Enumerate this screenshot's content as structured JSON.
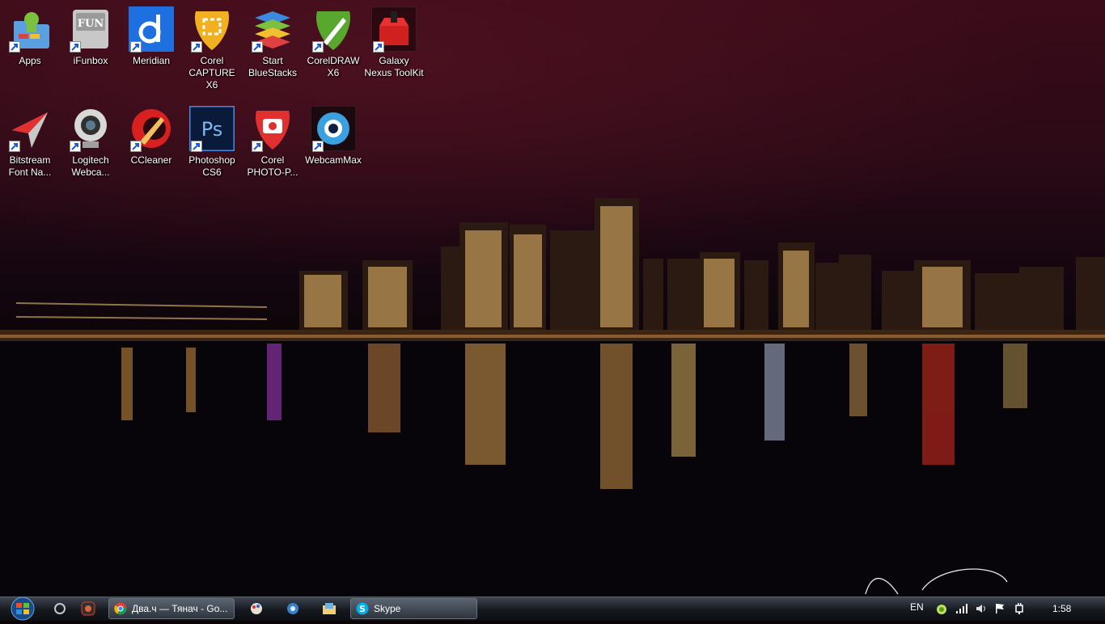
{
  "desktop": {
    "icons": [
      {
        "label": "Apps",
        "icon": "bluestacks-apps-folder-icon"
      },
      {
        "label": "iFunbox",
        "icon": "ifunbox-icon"
      },
      {
        "label": "Meridian",
        "icon": "meridian-icon"
      },
      {
        "label": "Corel CAPTURE X6",
        "icon": "corel-capture-icon"
      },
      {
        "label": "Start BlueStacks",
        "icon": "bluestacks-icon"
      },
      {
        "label": "CorelDRAW X6",
        "icon": "coreldraw-icon"
      },
      {
        "label": "Galaxy Nexus ToolKit",
        "icon": "toolkit-icon"
      },
      {
        "label": "Bitstream Font Na...",
        "icon": "bitstream-icon"
      },
      {
        "label": "Logitech Webca...",
        "icon": "webcam-icon"
      },
      {
        "label": "CCleaner",
        "icon": "ccleaner-icon"
      },
      {
        "label": "Photoshop CS6",
        "icon": "photoshop-icon"
      },
      {
        "label": "Corel PHOTO-P...",
        "icon": "corel-photo-paint-icon"
      },
      {
        "label": "WebcamMax",
        "icon": "webcammax-icon"
      }
    ]
  },
  "taskbar": {
    "tasks": [
      {
        "label": "Два.ч — Тянач - Go...",
        "icon": "chrome-icon"
      },
      {
        "label": "Skype",
        "icon": "skype-icon"
      }
    ],
    "tray": {
      "language": "EN",
      "clock": "1:58"
    }
  },
  "colors": {
    "sky_top": "#3a0c18",
    "water": "#05030a",
    "taskbar": "#1a1e24"
  }
}
